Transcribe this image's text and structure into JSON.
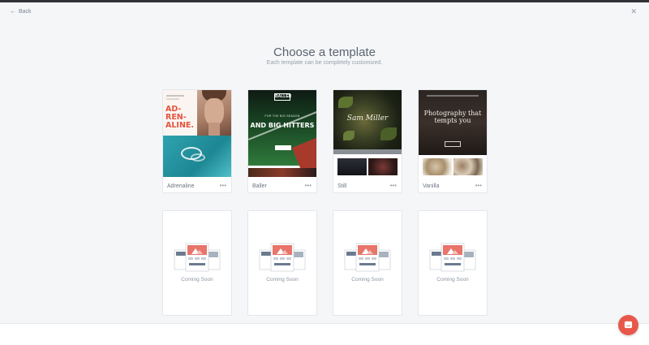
{
  "header": {
    "back_label": "Back",
    "close_icon": "close-icon"
  },
  "main": {
    "title": "Choose a template",
    "subtitle": "Each template can be completely customized."
  },
  "templates": [
    {
      "name": "Adrenaline",
      "preview_text": "AD-\nREN-\nALINE."
    },
    {
      "name": "Baller",
      "preview_logo": "BALLER",
      "preview_headline": "AND BIG HITTERS"
    },
    {
      "name": "Still",
      "preview_signature": "Sam Miller"
    },
    {
      "name": "Vanilla",
      "preview_headline": "Photography that tempts you"
    }
  ],
  "coming_soon": {
    "label": "Coming Soon",
    "count": 4
  },
  "colors": {
    "accent": "#e8584a",
    "background": "#f5f6f8"
  },
  "chat": {
    "icon": "chat-icon"
  }
}
